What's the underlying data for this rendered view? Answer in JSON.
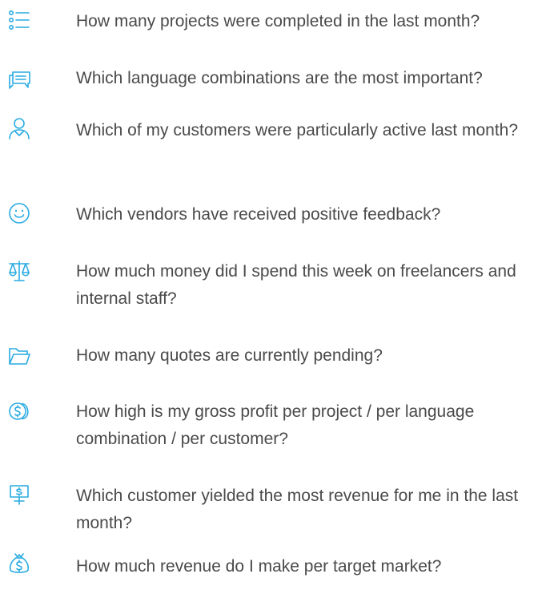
{
  "accent_color": "#29abe2",
  "text_color": "#4a4a4a",
  "questions": [
    {
      "icon": "list-icon",
      "text": "How many projects were completed in the last month?"
    },
    {
      "icon": "chat-icon",
      "text": "Which language combinations are the most important?"
    },
    {
      "icon": "user-icon",
      "text": "Which of my customers were particularly active last month?"
    },
    {
      "icon": "smiley-icon",
      "text": "Which vendors have received positive feedback?"
    },
    {
      "icon": "scales-icon",
      "text": "How much money did I spend this week on freelancers and internal staff?"
    },
    {
      "icon": "folder-icon",
      "text": "How many quotes are currently pending?"
    },
    {
      "icon": "coins-icon",
      "text": "How high is my gross profit per project / per language combination / per customer?"
    },
    {
      "icon": "presentation-icon",
      "text": "Which customer yielded the most revenue for me in the last month?"
    },
    {
      "icon": "money-bag-icon",
      "text": "How much revenue do I make per target market?"
    }
  ]
}
